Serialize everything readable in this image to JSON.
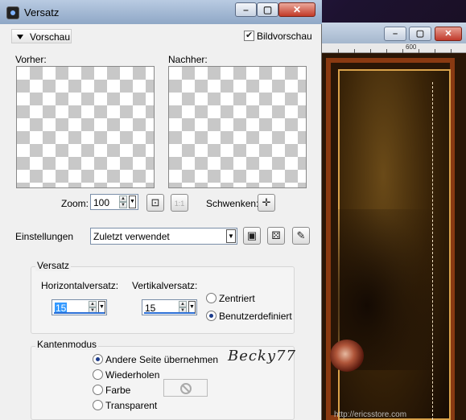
{
  "background": {
    "ruler_tick": "600",
    "url_text": "http://ericsstore.com"
  },
  "dialog": {
    "title": "Versatz",
    "section_label": "Vorschau",
    "preview_checkbox": {
      "label": "Bildvorschau",
      "checked": true
    },
    "before_label": "Vorher:",
    "after_label": "Nachher:",
    "zoom_label": "Zoom:",
    "zoom_value": "100",
    "pan_label": "Schwenken:",
    "settings_label": "Einstellungen",
    "settings_value": "Zuletzt verwendet",
    "offset_group": {
      "title": "Versatz",
      "horizontal_label": "Horizontalversatz:",
      "horizontal_value": "15",
      "vertical_label": "Vertikalversatz:",
      "vertical_value": "15",
      "options": [
        {
          "label": "Zentriert",
          "selected": false
        },
        {
          "label": "Benutzerdefiniert",
          "selected": true
        }
      ]
    },
    "edge_group": {
      "title": "Kantenmodus",
      "options": [
        {
          "label": "Andere Seite übernehmen",
          "selected": true
        },
        {
          "label": "Wiederholen",
          "selected": false
        },
        {
          "label": "Farbe",
          "selected": false
        },
        {
          "label": "Transparent",
          "selected": false
        }
      ]
    },
    "signature": "Becky77"
  },
  "colors": {
    "title_bar": "#9fb5d2",
    "selection": "#3399ff",
    "frame": "#8a3a12"
  }
}
